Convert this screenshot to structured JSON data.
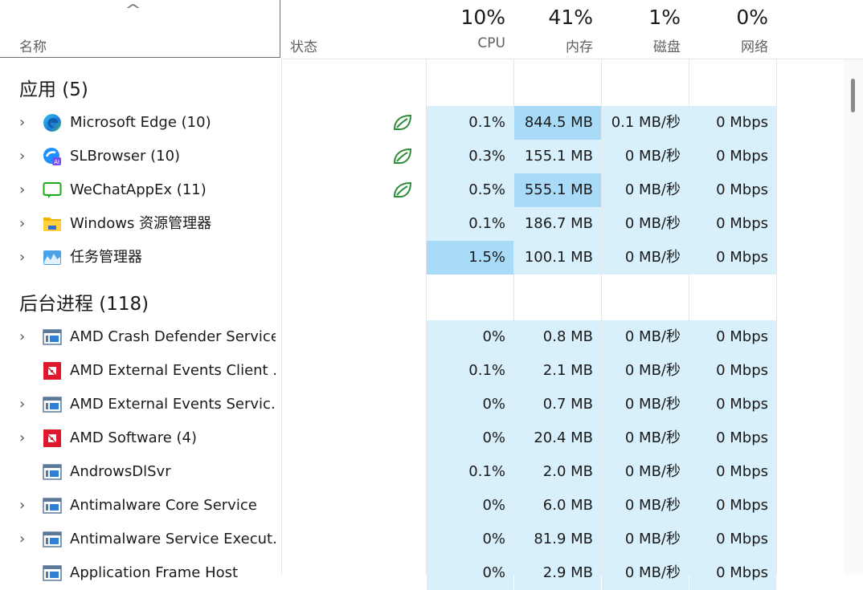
{
  "header": {
    "name_label": "名称",
    "status_label": "状态",
    "sort_glyph": "^",
    "cpu": {
      "pct": "10%",
      "label": "CPU"
    },
    "mem": {
      "pct": "41%",
      "label": "内存"
    },
    "disk": {
      "pct": "1%",
      "label": "磁盘"
    },
    "net": {
      "pct": "0%",
      "label": "网络"
    }
  },
  "groups": {
    "apps": "应用 (5)",
    "background": "后台进程 (118)"
  },
  "apps": [
    {
      "name": "Microsoft Edge (10)",
      "icon": "edge-icon",
      "expandable": true,
      "eco": true,
      "cpu": "0.1%",
      "mem": "844.5 MB",
      "disk": "0.1 MB/秒",
      "net": "0 Mbps",
      "mem_hot": true,
      "cpu_hot": false
    },
    {
      "name": "SLBrowser (10)",
      "icon": "slbrowser-icon",
      "expandable": true,
      "eco": true,
      "cpu": "0.3%",
      "mem": "155.1 MB",
      "disk": "0 MB/秒",
      "net": "0 Mbps",
      "mem_hot": false,
      "cpu_hot": false
    },
    {
      "name": "WeChatAppEx (11)",
      "icon": "wechat-icon",
      "expandable": true,
      "eco": true,
      "cpu": "0.5%",
      "mem": "555.1 MB",
      "disk": "0 MB/秒",
      "net": "0 Mbps",
      "mem_hot": true,
      "cpu_hot": false
    },
    {
      "name": "Windows 资源管理器",
      "icon": "folder-icon",
      "expandable": true,
      "eco": false,
      "cpu": "0.1%",
      "mem": "186.7 MB",
      "disk": "0 MB/秒",
      "net": "0 Mbps",
      "mem_hot": false,
      "cpu_hot": false
    },
    {
      "name": "任务管理器",
      "icon": "task-manager-icon",
      "expandable": true,
      "eco": false,
      "cpu": "1.5%",
      "mem": "100.1 MB",
      "disk": "0 MB/秒",
      "net": "0 Mbps",
      "mem_hot": false,
      "cpu_hot": true
    }
  ],
  "background": [
    {
      "name": "AMD Crash Defender Service",
      "icon": "service-icon",
      "expandable": true,
      "cpu": "0%",
      "mem": "0.8 MB",
      "disk": "0 MB/秒",
      "net": "0 Mbps"
    },
    {
      "name": "AMD External Events Client ...",
      "icon": "amd-icon",
      "expandable": false,
      "cpu": "0.1%",
      "mem": "2.1 MB",
      "disk": "0 MB/秒",
      "net": "0 Mbps"
    },
    {
      "name": "AMD External Events Servic...",
      "icon": "service-icon",
      "expandable": true,
      "cpu": "0%",
      "mem": "0.7 MB",
      "disk": "0 MB/秒",
      "net": "0 Mbps"
    },
    {
      "name": "AMD Software (4)",
      "icon": "amd-icon",
      "expandable": true,
      "cpu": "0%",
      "mem": "20.4 MB",
      "disk": "0 MB/秒",
      "net": "0 Mbps"
    },
    {
      "name": "AndrowsDlSvr",
      "icon": "service-icon",
      "expandable": false,
      "cpu": "0.1%",
      "mem": "2.0 MB",
      "disk": "0 MB/秒",
      "net": "0 Mbps"
    },
    {
      "name": "Antimalware Core Service",
      "icon": "service-icon",
      "expandable": true,
      "cpu": "0%",
      "mem": "6.0 MB",
      "disk": "0 MB/秒",
      "net": "0 Mbps"
    },
    {
      "name": "Antimalware Service Execut...",
      "icon": "service-icon",
      "expandable": true,
      "cpu": "0%",
      "mem": "81.9 MB",
      "disk": "0 MB/秒",
      "net": "0 Mbps"
    },
    {
      "name": "Application Frame Host",
      "icon": "service-icon",
      "expandable": false,
      "cpu": "0%",
      "mem": "2.9 MB",
      "disk": "0 MB/秒",
      "net": "0 Mbps"
    }
  ],
  "chevron_glyph": "›",
  "colors": {
    "cell": "#d8effc",
    "cell_hot": "#a9dbf8",
    "eco_leaf": "#2e8b3a",
    "amd_red": "#e0182d"
  }
}
